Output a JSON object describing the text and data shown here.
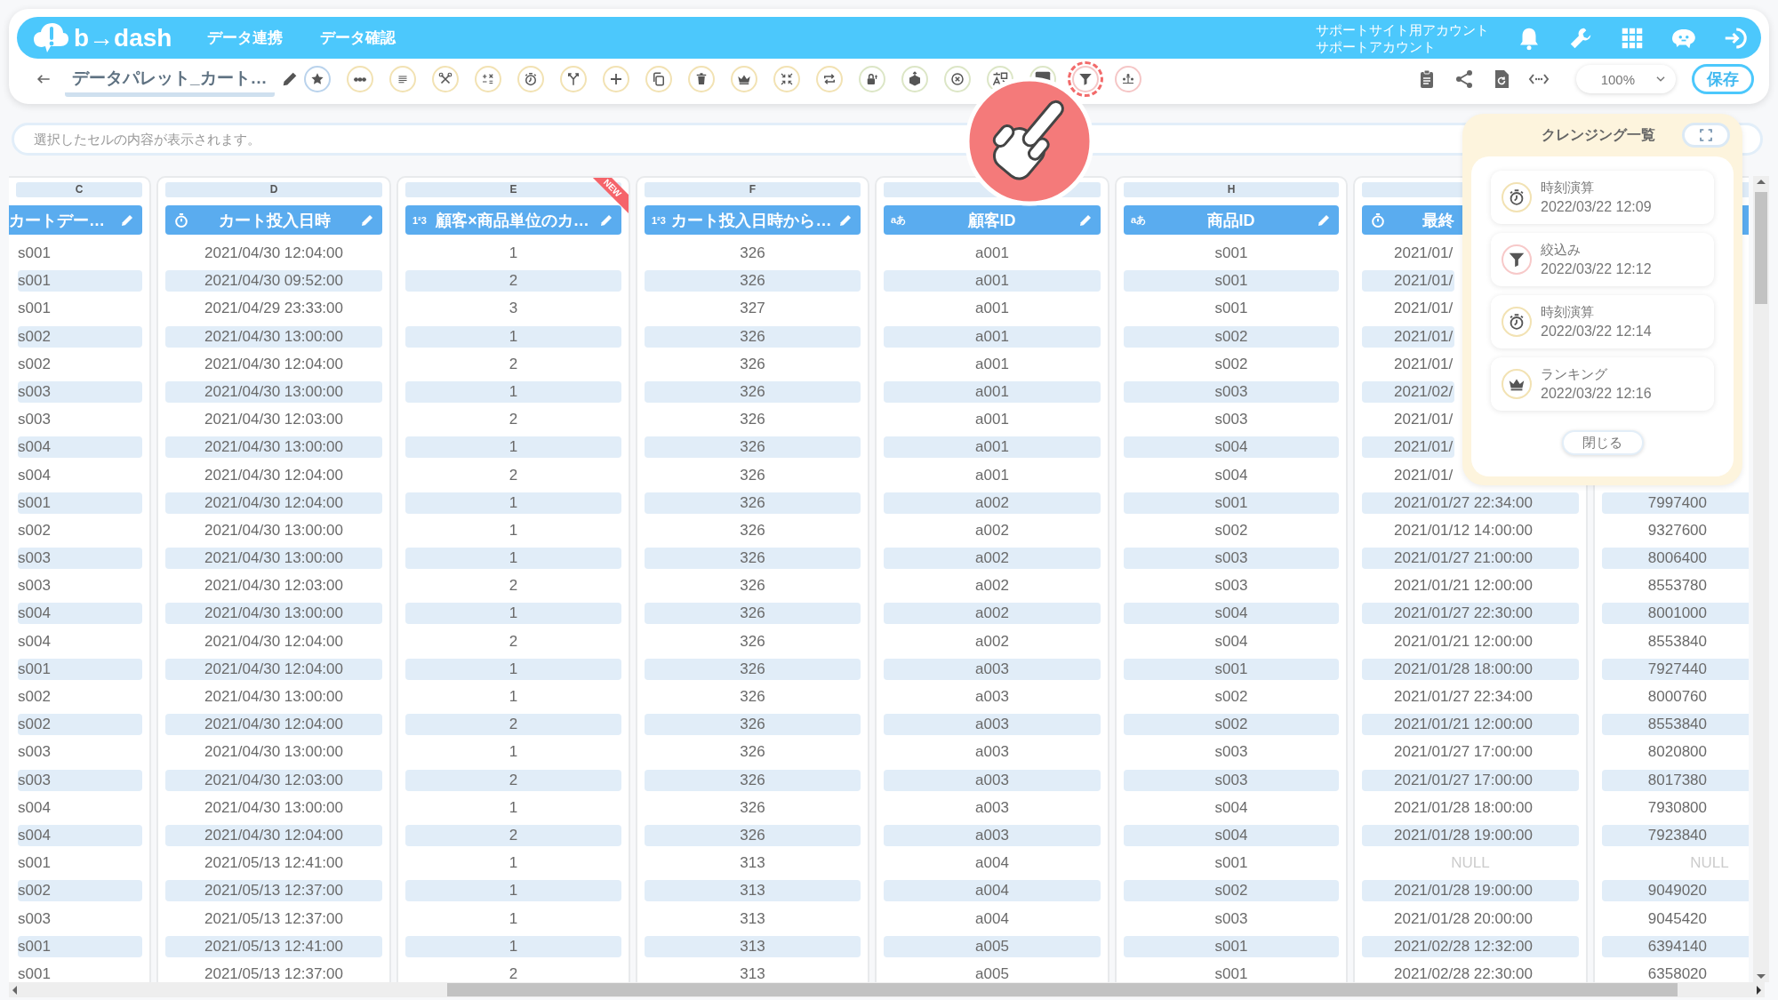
{
  "header": {
    "logo": "b→dash",
    "nav": [
      {
        "label": "データ連携"
      },
      {
        "label": "データ確認"
      }
    ],
    "account": [
      "サポートサイト用アカウント",
      "サポートアカウント"
    ]
  },
  "toolbar": {
    "title": "データパレット_カート…",
    "tools": [
      {
        "kind": "star",
        "color": "#bad3ec",
        "highlighted": false
      },
      {
        "kind": "dots",
        "color": "#f2e2b3",
        "highlighted": false
      },
      {
        "kind": "lines",
        "color": "#f2e2b3",
        "highlighted": false
      },
      {
        "kind": "tools",
        "color": "#f2e2b3",
        "highlighted": false
      },
      {
        "kind": "calc",
        "color": "#f2e2b3",
        "highlighted": false
      },
      {
        "kind": "timer",
        "color": "#f2e2b3",
        "highlighted": false
      },
      {
        "kind": "branch",
        "color": "#f2e2b3",
        "highlighted": false
      },
      {
        "kind": "plus",
        "color": "#f2e2b3",
        "highlighted": false
      },
      {
        "kind": "copy",
        "color": "#f2e2b3",
        "highlighted": false
      },
      {
        "kind": "trash",
        "color": "#f2e2b3",
        "highlighted": false
      },
      {
        "kind": "crown",
        "color": "#f2e2b3",
        "highlighted": false
      },
      {
        "kind": "compress",
        "color": "#f2e2b3",
        "highlighted": false
      },
      {
        "kind": "repeat",
        "color": "#f2e2b3",
        "highlighted": false
      },
      {
        "kind": "lock",
        "color": "#dce6c6",
        "highlighted": false
      },
      {
        "kind": "box",
        "color": "#dce6c6",
        "highlighted": false
      },
      {
        "kind": "xcircle",
        "color": "#dce6c6",
        "highlighted": false
      },
      {
        "kind": "translate",
        "color": "#dce6c6",
        "highlighted": false
      },
      {
        "kind": "square",
        "color": "#dce6c6",
        "highlighted": false
      },
      {
        "kind": "filter",
        "color": "#f5c6c6",
        "highlighted": true
      },
      {
        "kind": "people",
        "color": "#f5c6c6",
        "highlighted": false
      }
    ],
    "zoom": "100%",
    "save": "保存"
  },
  "formula": {
    "placeholder": "選択したセルの内容が表示されます。"
  },
  "columns": [
    {
      "letter": "C",
      "label": "カートデー…",
      "kind": "none",
      "editable": true
    },
    {
      "letter": "D",
      "label": "カート投入日時",
      "kind": "timer",
      "editable": true
    },
    {
      "letter": "E",
      "label": "顧客×商品単位のカ…",
      "kind": "mark",
      "mark": "1²3",
      "badge": "NEW",
      "editable": true
    },
    {
      "letter": "F",
      "label": "カート投入日時から…",
      "kind": "mark",
      "mark": "1²3",
      "editable": true
    },
    {
      "label": "顧客ID",
      "kind": "mark",
      "mark": "aあ",
      "editable": true
    },
    {
      "letter": "H",
      "label": "商品ID",
      "kind": "mark",
      "mark": "aあ",
      "editable": true
    },
    {
      "label": "最終",
      "kind": "timer",
      "editable": false
    },
    {
      "kind": "none"
    }
  ],
  "rows": [
    {
      "cells": [
        "s001",
        "2021/04/30 12:04:00",
        "1",
        "326",
        "a001",
        "s001",
        "2021/01/"
      ]
    },
    {
      "cells": [
        "s001",
        "2021/04/30 09:52:00",
        "2",
        "326",
        "a001",
        "s001",
        "2021/01/"
      ]
    },
    {
      "cells": [
        "s001",
        "2021/04/29 23:33:00",
        "3",
        "327",
        "a001",
        "s001",
        "2021/01/"
      ]
    },
    {
      "cells": [
        "s002",
        "2021/04/30 13:00:00",
        "1",
        "326",
        "a001",
        "s002",
        "2021/01/"
      ]
    },
    {
      "cells": [
        "s002",
        "2021/04/30 12:04:00",
        "2",
        "326",
        "a001",
        "s002",
        "2021/01/"
      ]
    },
    {
      "cells": [
        "s003",
        "2021/04/30 13:00:00",
        "1",
        "326",
        "a001",
        "s003",
        "2021/02/"
      ]
    },
    {
      "cells": [
        "s003",
        "2021/04/30 12:03:00",
        "2",
        "326",
        "a001",
        "s003",
        "2021/01/"
      ]
    },
    {
      "cells": [
        "s004",
        "2021/04/30 13:00:00",
        "1",
        "326",
        "a001",
        "s004",
        "2021/01/"
      ]
    },
    {
      "cells": [
        "s004",
        "2021/04/30 12:04:00",
        "2",
        "326",
        "a001",
        "s004",
        "2021/01/"
      ]
    },
    {
      "cells": [
        "s001",
        "2021/04/30 12:04:00",
        "1",
        "326",
        "a002",
        "s001",
        "2021/01/27 22:34:00",
        "7997400"
      ]
    },
    {
      "cells": [
        "s002",
        "2021/04/30 13:00:00",
        "1",
        "326",
        "a002",
        "s002",
        "2021/01/12 14:00:00",
        "9327600"
      ]
    },
    {
      "cells": [
        "s003",
        "2021/04/30 13:00:00",
        "1",
        "326",
        "a002",
        "s003",
        "2021/01/27 21:00:00",
        "8006400"
      ]
    },
    {
      "cells": [
        "s003",
        "2021/04/30 12:03:00",
        "2",
        "326",
        "a002",
        "s003",
        "2021/01/21 12:00:00",
        "8553780"
      ]
    },
    {
      "cells": [
        "s004",
        "2021/04/30 13:00:00",
        "1",
        "326",
        "a002",
        "s004",
        "2021/01/27 22:30:00",
        "8001000"
      ]
    },
    {
      "cells": [
        "s004",
        "2021/04/30 12:04:00",
        "2",
        "326",
        "a002",
        "s004",
        "2021/01/21 12:00:00",
        "8553840"
      ]
    },
    {
      "cells": [
        "s001",
        "2021/04/30 12:04:00",
        "1",
        "326",
        "a003",
        "s001",
        "2021/01/28 18:00:00",
        "7927440"
      ]
    },
    {
      "cells": [
        "s002",
        "2021/04/30 13:00:00",
        "1",
        "326",
        "a003",
        "s002",
        "2021/01/27 22:34:00",
        "8000760"
      ]
    },
    {
      "cells": [
        "s002",
        "2021/04/30 12:04:00",
        "2",
        "326",
        "a003",
        "s002",
        "2021/01/21 12:00:00",
        "8553840"
      ]
    },
    {
      "cells": [
        "s003",
        "2021/04/30 13:00:00",
        "1",
        "326",
        "a003",
        "s003",
        "2021/01/27 17:00:00",
        "8020800"
      ]
    },
    {
      "cells": [
        "s003",
        "2021/04/30 12:03:00",
        "2",
        "326",
        "a003",
        "s003",
        "2021/01/27 17:00:00",
        "8017380"
      ]
    },
    {
      "cells": [
        "s004",
        "2021/04/30 13:00:00",
        "1",
        "326",
        "a003",
        "s004",
        "2021/01/28 18:00:00",
        "7930800"
      ]
    },
    {
      "cells": [
        "s004",
        "2021/04/30 12:04:00",
        "2",
        "326",
        "a003",
        "s004",
        "2021/01/28 19:00:00",
        "7923840"
      ]
    },
    {
      "cells": [
        "s001",
        "2021/05/13 12:41:00",
        "1",
        "313",
        "a004",
        "s001",
        {
          "text": "NULL",
          "null": true
        },
        {
          "text": "NULL",
          "null": true
        }
      ]
    },
    {
      "cells": [
        "s002",
        "2021/05/13 12:37:00",
        "1",
        "313",
        "a004",
        "s002",
        "2021/01/28 19:00:00",
        "9049020"
      ]
    },
    {
      "cells": [
        "s003",
        "2021/05/13 12:37:00",
        "1",
        "313",
        "a004",
        "s003",
        "2021/01/28 20:00:00",
        "9045420"
      ]
    },
    {
      "cells": [
        "s001",
        "2021/05/13 12:41:00",
        "1",
        "313",
        "a005",
        "s001",
        "2021/02/28 12:32:00",
        "6394140"
      ]
    },
    {
      "cells": [
        "s001",
        "2021/05/13 12:37:00",
        "2",
        "313",
        "a005",
        "s001",
        "2021/02/28 22:30:00",
        "6358020"
      ]
    }
  ],
  "panel": {
    "title": "クレンジング一覧",
    "items": [
      {
        "kind": "timer",
        "name": "時刻演算",
        "time": "2022/03/22 12:09"
      },
      {
        "kind": "filter",
        "name": "絞込み",
        "time": "2022/03/22 12:12"
      },
      {
        "kind": "timer",
        "name": "時刻演算",
        "time": "2022/03/22 12:14"
      },
      {
        "kind": "crown",
        "name": "ランキング",
        "time": "2022/03/22 12:16"
      }
    ],
    "close": "閉じる"
  }
}
